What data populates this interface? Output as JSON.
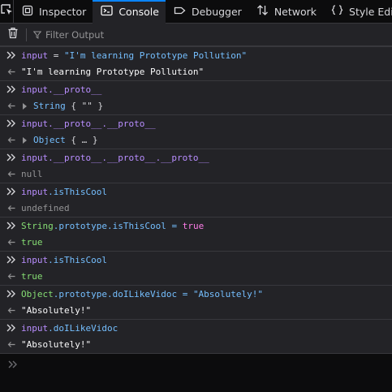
{
  "toolbar": {
    "tabs": {
      "inspector": "Inspector",
      "console": "Console",
      "debugger": "Debugger",
      "network": "Network",
      "style_editor": "Style Editor"
    },
    "selected_tab": "Console",
    "accent_color": "#0a84ff"
  },
  "filter": {
    "placeholder": "Filter Output"
  },
  "console": {
    "entries": [
      {
        "input": {
          "var": "input",
          "op": " = ",
          "str": "\"I'm learning Prototype Pollution\""
        },
        "result": {
          "text": "\"I'm learning Prototype Pollution\""
        }
      },
      {
        "input": {
          "var": "input.__proto__"
        },
        "result": {
          "obj_type": "String",
          "obj_preview": "{ \"\" }"
        }
      },
      {
        "input": {
          "var": "input.__proto__.__proto__"
        },
        "result": {
          "obj_type": "Object",
          "obj_preview": "{ … }"
        }
      },
      {
        "input": {
          "var": "input.__proto__.__proto__.__proto__"
        },
        "result": {
          "text": "null"
        }
      },
      {
        "input": {
          "var": "input",
          "prop": ".isThisCool"
        },
        "result": {
          "text": "undefined"
        }
      },
      {
        "input": {
          "green": "String",
          "plain": ".prototype.isThisCool = ",
          "kw": "true"
        },
        "result": {
          "text": "true"
        }
      },
      {
        "input": {
          "var": "input",
          "prop": ".isThisCool"
        },
        "result": {
          "text": "true"
        }
      },
      {
        "input": {
          "green": "Object",
          "plain": ".prototype.doILikeVidoc = ",
          "str": "\"Absolutely!\""
        },
        "result": {
          "text": "\"Absolutely!\""
        }
      },
      {
        "input": {
          "var": "input",
          "prop": ".doILikeVidoc"
        },
        "result": {
          "text": "\"Absolutely!\""
        }
      }
    ]
  },
  "icons": {
    "picker": "element-picker-icon",
    "inspector": "inspector-icon",
    "console": "console-icon",
    "debugger": "debugger-icon",
    "network": "network-icon",
    "style_editor": "style-editor-icon",
    "clear": "trash-icon",
    "filter": "filter-icon",
    "input_marker": "chevron-double-right-icon",
    "result_marker": "arrow-left-icon"
  }
}
